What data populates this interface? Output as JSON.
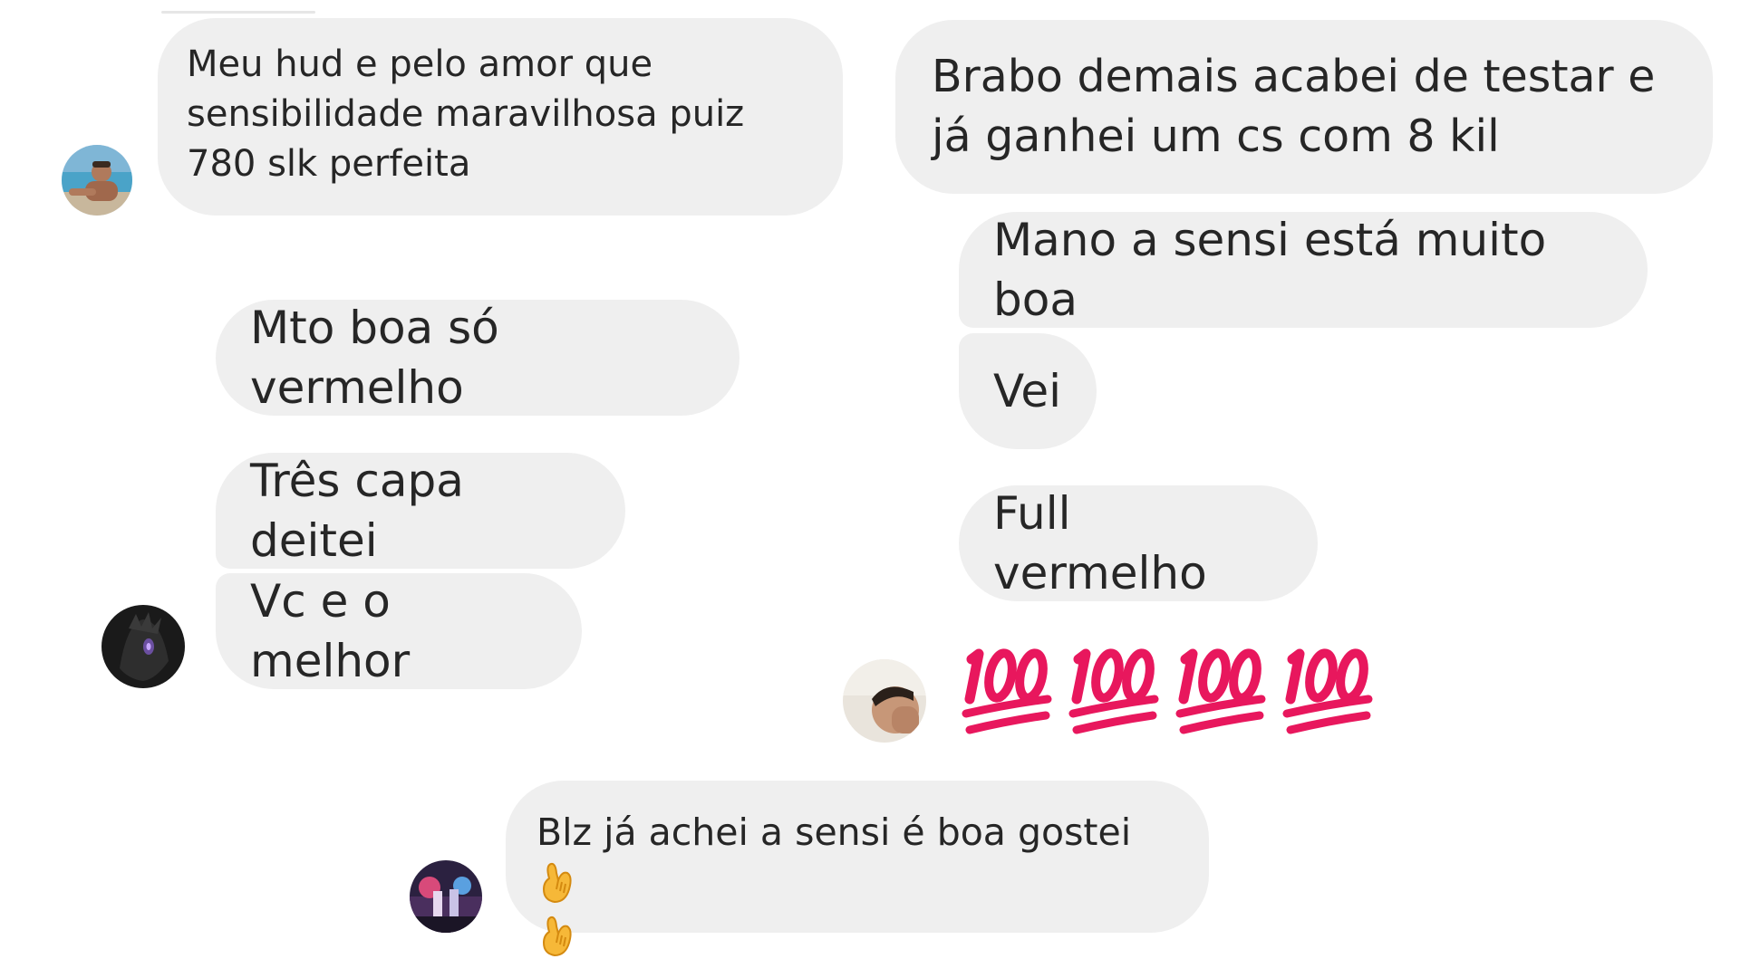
{
  "messages": {
    "m1": "Meu hud e pelo amor que sensibilidade maravilhosa puiz 780 slk perfeita",
    "m2": "Brabo demais acabei de testar e já ganhei um cs com 8 kil",
    "m3": "Mano a sensi está muito boa",
    "m4": "Mto boa só vermelho",
    "m5": "Vei",
    "m6": "Três capa deitei",
    "m7": "Full vermelho",
    "m8": "Vc e o melhor",
    "m9": "Blz já achei a sensi é boa gostei"
  },
  "reactions": {
    "hundred_count": 4,
    "hundred_emoji": "hundred-points-icon",
    "hand_emoji": "call-me-hand-icon"
  },
  "colors": {
    "bubble": "#efefef",
    "text": "#262626",
    "hundred_red": "#e8175d"
  }
}
